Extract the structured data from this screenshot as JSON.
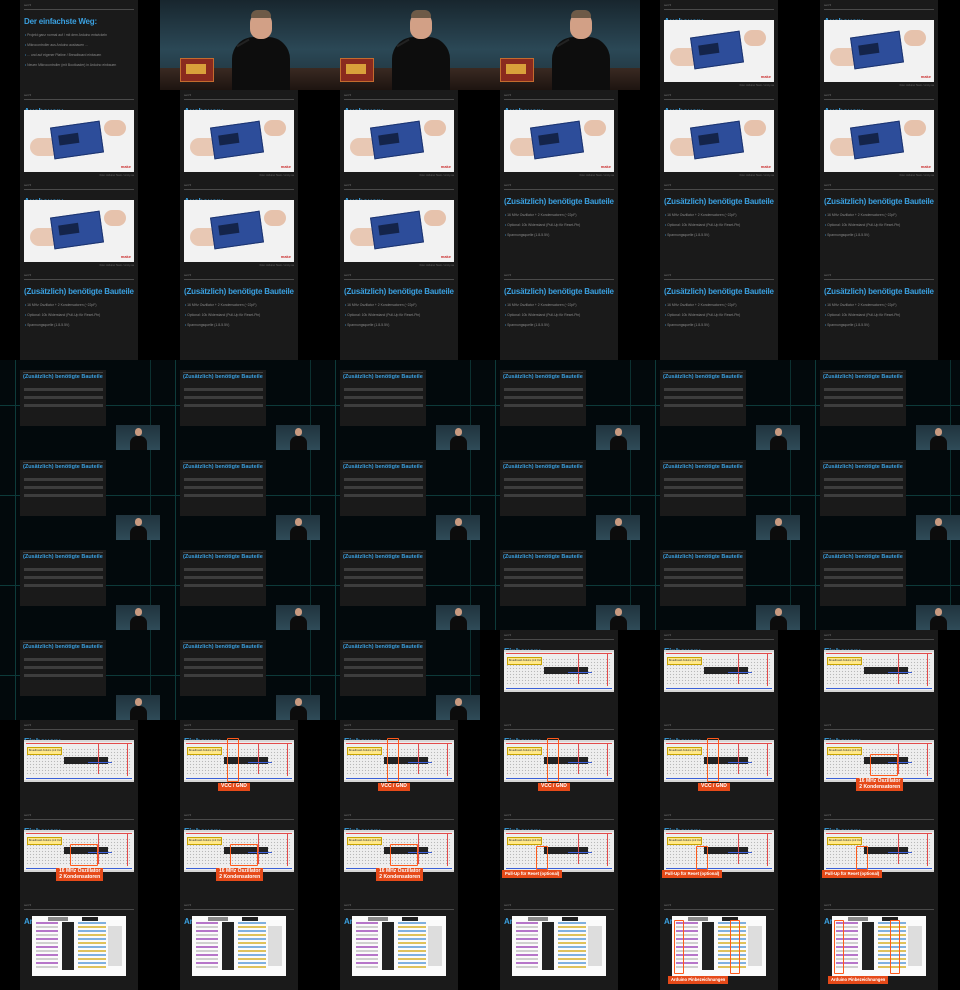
{
  "slide_header": "seit 5",
  "title_way": "Der einfachste Weg:",
  "way_items": [
    "Projekt ganz normal auf / mit dem Arduino entwickeln",
    "Mikrocontroller aus Arduino ausbauen ...",
    "... und auf eigener Platine / Breadboard einbauen",
    "Neuen Mikrocontroller (mit Bootloader) in Arduino einbauen"
  ],
  "title_ausbauen": "Ausbauen:",
  "title_bauteile": "(Zusätzlich) benötigte Bauteile",
  "parts": [
    "16 MHz Oszillator + 2 Kondensatoren (~22pF)",
    "Optional: 10k Widerstand (Pull-Up für Reset-Pin)",
    "Spannungsquelle (1.8-5.5V)"
  ],
  "title_einbauen": "Einbauen:",
  "title_anschliessen": "Anschließen:",
  "breadboard_label": "Breadboard Arduino (mit Oszillator)",
  "photo_logo": "make",
  "photo_source": "Foto: Arduino Team / cc-by-sa",
  "pinout_tag": "ATmega168",
  "callouts": {
    "vcc_gnd": "VCC / GND",
    "osc_line1": "16 MHz Oszillator",
    "osc_line2": "2 Kondensatoren",
    "pullup": "Pull-Up für Reset (optional)",
    "pinnames": "Arduino Pinbezeichnungen"
  },
  "layout": {
    "columns": 6,
    "rows": 11,
    "tiles": [
      [
        "text-way",
        "video",
        "video",
        "video",
        "photo",
        "photo"
      ],
      [
        "photo",
        "photo",
        "photo",
        "photo",
        "photo",
        "photo"
      ],
      [
        "photo",
        "photo",
        "photo",
        "parts",
        "parts",
        "parts"
      ],
      [
        "parts",
        "parts",
        "parts",
        "parts",
        "parts",
        "parts"
      ],
      [
        "circuit",
        "circuit",
        "circuit",
        "circuit",
        "circuit",
        "circuit"
      ],
      [
        "circuit",
        "circuit",
        "circuit",
        "circuit",
        "circuit",
        "circuit"
      ],
      [
        "circuit",
        "circuit",
        "circuit",
        "circuit",
        "circuit",
        "circuit"
      ],
      [
        "circuit",
        "circuit",
        "circuit",
        "einbauen-plain",
        "einbauen-plain",
        "einbauen-plain"
      ],
      [
        "einbauen-plain",
        "einbauen-vcc",
        "einbauen-vcc",
        "einbauen-vcc",
        "einbauen-vcc",
        "einbauen-osc"
      ],
      [
        "einbauen-osc",
        "einbauen-osc",
        "einbauen-osc",
        "einbauen-pullup",
        "einbauen-pullup",
        "einbauen-pullup"
      ],
      [
        "anschliessen",
        "anschliessen",
        "anschliessen",
        "anschliessen",
        "anschliessen-pins",
        "anschliessen-pins"
      ]
    ]
  },
  "colors": {
    "title_blue": "#3aa0e0",
    "callout_orange": "#e64a19",
    "slide_bg": "#1a1a1a"
  }
}
